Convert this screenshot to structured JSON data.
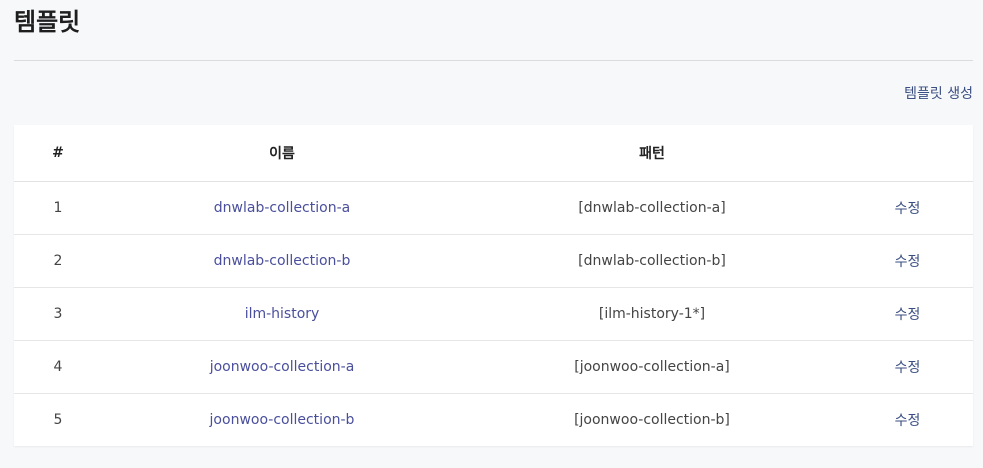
{
  "page": {
    "title": "템플릿",
    "create_label": "템플릿 생성"
  },
  "table": {
    "headers": {
      "num": "#",
      "name": "이름",
      "pattern": "패턴",
      "action": ""
    },
    "rows": [
      {
        "num": "1",
        "name": "dnwlab-collection-a",
        "pattern": "[dnwlab-collection-a]",
        "action": "수정"
      },
      {
        "num": "2",
        "name": "dnwlab-collection-b",
        "pattern": "[dnwlab-collection-b]",
        "action": "수정"
      },
      {
        "num": "3",
        "name": "ilm-history",
        "pattern": "[ilm-history-1*]",
        "action": "수정"
      },
      {
        "num": "4",
        "name": "joonwoo-collection-a",
        "pattern": "[joonwoo-collection-a]",
        "action": "수정"
      },
      {
        "num": "5",
        "name": "joonwoo-collection-b",
        "pattern": "[joonwoo-collection-b]",
        "action": "수정"
      }
    ]
  }
}
